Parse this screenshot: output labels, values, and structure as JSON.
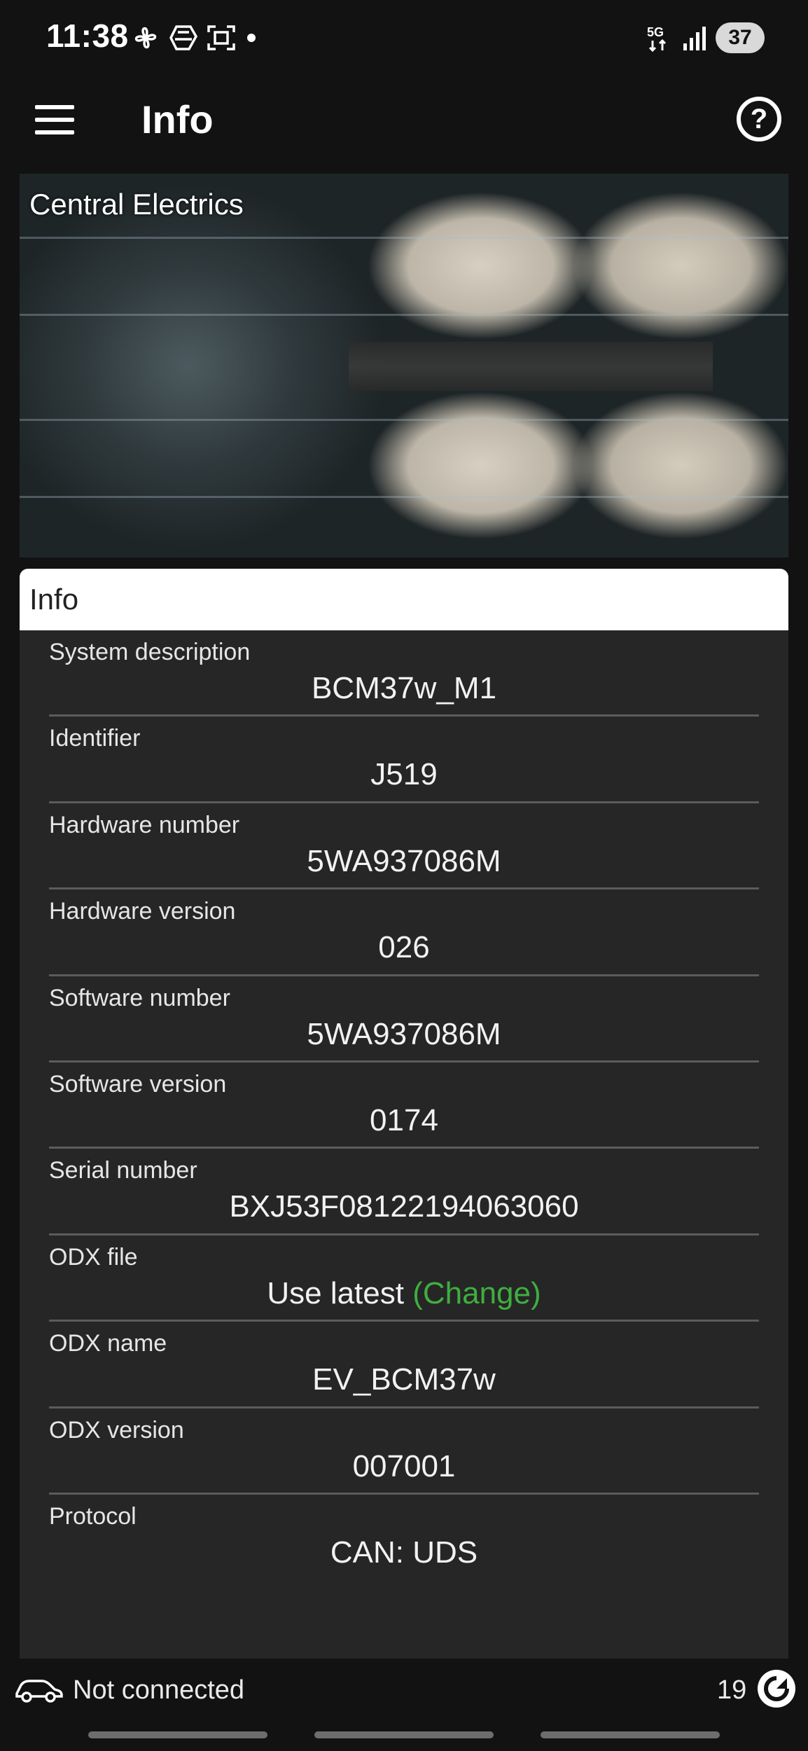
{
  "status_bar": {
    "time": "11:38",
    "network": "5G",
    "battery": "37"
  },
  "app_bar": {
    "title": "Info",
    "menu_icon": "hamburger-menu-icon",
    "help_icon": "help-circle-icon"
  },
  "hero": {
    "title": "Central Electrics"
  },
  "info_card": {
    "header": "Info",
    "rows": [
      {
        "label": "System description",
        "value": "BCM37w_M1"
      },
      {
        "label": "Identifier",
        "value": "J519"
      },
      {
        "label": "Hardware number",
        "value": "5WA937086M"
      },
      {
        "label": "Hardware version",
        "value": "026"
      },
      {
        "label": "Software number",
        "value": "5WA937086M"
      },
      {
        "label": "Software version",
        "value": "0174"
      },
      {
        "label": "Serial number",
        "value": "BXJ53F08122194063060"
      },
      {
        "label": "ODX file",
        "value": "Use latest",
        "link": "(Change)"
      },
      {
        "label": "ODX name",
        "value": "EV_BCM37w"
      },
      {
        "label": "ODX version",
        "value": "007001"
      },
      {
        "label": "Protocol",
        "value": "CAN: UDS"
      }
    ]
  },
  "bottom_bar": {
    "connection_status": "Not connected",
    "count": "19"
  },
  "colors": {
    "background": "#121212",
    "card": "#262626",
    "link_green": "#3fae3f",
    "divider": "#5c5c5c"
  }
}
